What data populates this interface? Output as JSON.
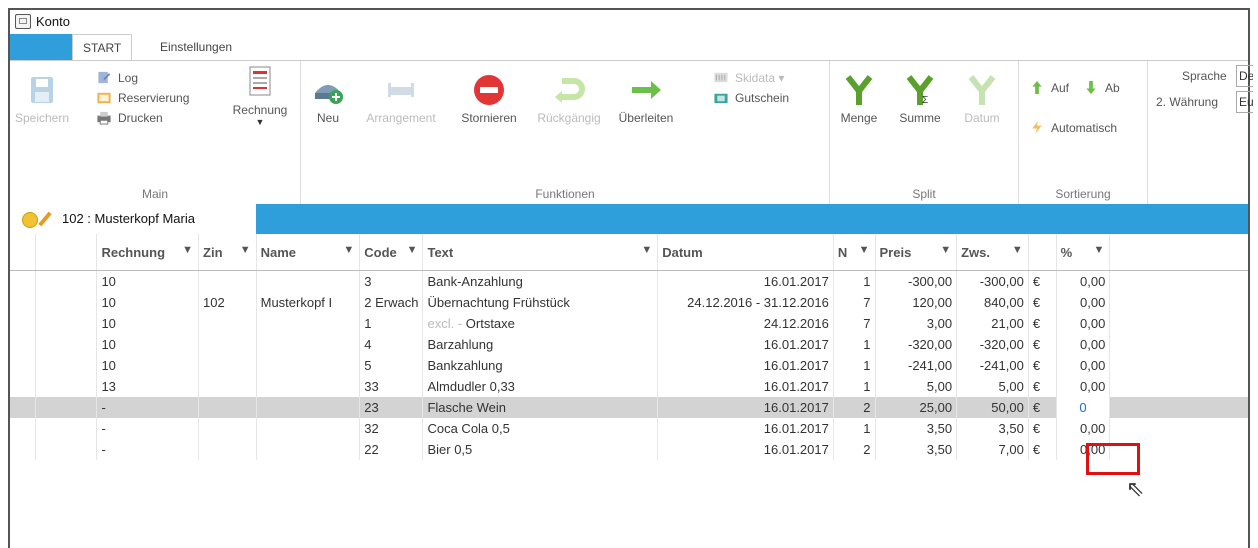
{
  "window": {
    "title": "Konto"
  },
  "tabs": {
    "start": "START",
    "settings": "Einstellungen"
  },
  "ribbon": {
    "main": {
      "label": "Main",
      "speichern": "Speichern",
      "log": "Log",
      "reservierung": "Reservierung",
      "drucken": "Drucken",
      "rechnung": "Rechnung"
    },
    "funktionen": {
      "label": "Funktionen",
      "neu": "Neu",
      "arrangement": "Arrangement",
      "stornieren": "Stornieren",
      "rueckgaengig": "Rückgängig",
      "ueberleiten": "Überleiten",
      "skidata": "Skidata ▾",
      "gutschein": "Gutschein"
    },
    "split": {
      "label": "Split",
      "menge": "Menge",
      "summe": "Summe",
      "datum": "Datum"
    },
    "sortierung": {
      "label": "Sortierung",
      "auf": "Auf",
      "ab": "Ab",
      "automatisch": "Automatisch"
    },
    "settings": {
      "sprache_label": "Sprache",
      "sprache_value": "De",
      "waehrung_label": "2. Währung",
      "waehrung_value": "Eu"
    }
  },
  "customer": {
    "label": "102 : Musterkopf Maria"
  },
  "table": {
    "columns": [
      "Rechnung",
      "Zin",
      "Name",
      "Code",
      "Text",
      "Datum",
      "N",
      "Preis",
      "Zws.",
      "%"
    ],
    "rows": [
      [
        "10",
        "",
        "",
        "3",
        "Bank-Anzahlung",
        "16.01.2017",
        "1",
        "-300,00",
        "-300,00",
        "€",
        "0,00"
      ],
      [
        "10",
        "102",
        "Musterkopf I",
        "2 Erwach",
        "Übernachtung Frühstück",
        "24.12.2016 - 31.12.2016",
        "7",
        "120,00",
        "840,00",
        "€",
        "0,00"
      ],
      [
        "10",
        "",
        "",
        "1",
        "excl. - Ortstaxe",
        "24.12.2016",
        "7",
        "3,00",
        "21,00",
        "€",
        "0,00"
      ],
      [
        "10",
        "",
        "",
        "4",
        "Barzahlung",
        "16.01.2017",
        "1",
        "-320,00",
        "-320,00",
        "€",
        "0,00"
      ],
      [
        "10",
        "",
        "",
        "5",
        "Bankzahlung",
        "16.01.2017",
        "1",
        "-241,00",
        "-241,00",
        "€",
        "0,00"
      ],
      [
        "13",
        "",
        "",
        "33",
        "Almdudler 0,33",
        "16.01.2017",
        "1",
        "5,00",
        "5,00",
        "€",
        "0,00"
      ],
      [
        "-",
        "",
        "",
        "23",
        "Flasche Wein",
        "16.01.2017",
        "2",
        "25,00",
        "50,00",
        "€",
        "0"
      ],
      [
        "-",
        "",
        "",
        "32",
        "Coca Cola 0,5",
        "16.01.2017",
        "1",
        "3,50",
        "3,50",
        "€",
        "0,00"
      ],
      [
        "-",
        "",
        "",
        "22",
        "Bier 0,5",
        "16.01.2017",
        "2",
        "3,50",
        "7,00",
        "€",
        "0,00"
      ]
    ],
    "selected_row": 6
  }
}
